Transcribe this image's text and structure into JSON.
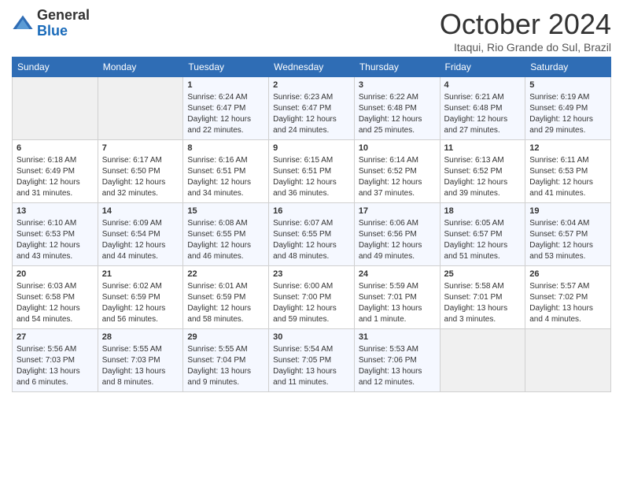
{
  "logo": {
    "general": "General",
    "blue": "Blue"
  },
  "header": {
    "month": "October 2024",
    "location": "Itaqui, Rio Grande do Sul, Brazil"
  },
  "days_of_week": [
    "Sunday",
    "Monday",
    "Tuesday",
    "Wednesday",
    "Thursday",
    "Friday",
    "Saturday"
  ],
  "weeks": [
    [
      {
        "day": "",
        "content": ""
      },
      {
        "day": "",
        "content": ""
      },
      {
        "day": "1",
        "content": "Sunrise: 6:24 AM\nSunset: 6:47 PM\nDaylight: 12 hours\nand 22 minutes."
      },
      {
        "day": "2",
        "content": "Sunrise: 6:23 AM\nSunset: 6:47 PM\nDaylight: 12 hours\nand 24 minutes."
      },
      {
        "day": "3",
        "content": "Sunrise: 6:22 AM\nSunset: 6:48 PM\nDaylight: 12 hours\nand 25 minutes."
      },
      {
        "day": "4",
        "content": "Sunrise: 6:21 AM\nSunset: 6:48 PM\nDaylight: 12 hours\nand 27 minutes."
      },
      {
        "day": "5",
        "content": "Sunrise: 6:19 AM\nSunset: 6:49 PM\nDaylight: 12 hours\nand 29 minutes."
      }
    ],
    [
      {
        "day": "6",
        "content": "Sunrise: 6:18 AM\nSunset: 6:49 PM\nDaylight: 12 hours\nand 31 minutes."
      },
      {
        "day": "7",
        "content": "Sunrise: 6:17 AM\nSunset: 6:50 PM\nDaylight: 12 hours\nand 32 minutes."
      },
      {
        "day": "8",
        "content": "Sunrise: 6:16 AM\nSunset: 6:51 PM\nDaylight: 12 hours\nand 34 minutes."
      },
      {
        "day": "9",
        "content": "Sunrise: 6:15 AM\nSunset: 6:51 PM\nDaylight: 12 hours\nand 36 minutes."
      },
      {
        "day": "10",
        "content": "Sunrise: 6:14 AM\nSunset: 6:52 PM\nDaylight: 12 hours\nand 37 minutes."
      },
      {
        "day": "11",
        "content": "Sunrise: 6:13 AM\nSunset: 6:52 PM\nDaylight: 12 hours\nand 39 minutes."
      },
      {
        "day": "12",
        "content": "Sunrise: 6:11 AM\nSunset: 6:53 PM\nDaylight: 12 hours\nand 41 minutes."
      }
    ],
    [
      {
        "day": "13",
        "content": "Sunrise: 6:10 AM\nSunset: 6:53 PM\nDaylight: 12 hours\nand 43 minutes."
      },
      {
        "day": "14",
        "content": "Sunrise: 6:09 AM\nSunset: 6:54 PM\nDaylight: 12 hours\nand 44 minutes."
      },
      {
        "day": "15",
        "content": "Sunrise: 6:08 AM\nSunset: 6:55 PM\nDaylight: 12 hours\nand 46 minutes."
      },
      {
        "day": "16",
        "content": "Sunrise: 6:07 AM\nSunset: 6:55 PM\nDaylight: 12 hours\nand 48 minutes."
      },
      {
        "day": "17",
        "content": "Sunrise: 6:06 AM\nSunset: 6:56 PM\nDaylight: 12 hours\nand 49 minutes."
      },
      {
        "day": "18",
        "content": "Sunrise: 6:05 AM\nSunset: 6:57 PM\nDaylight: 12 hours\nand 51 minutes."
      },
      {
        "day": "19",
        "content": "Sunrise: 6:04 AM\nSunset: 6:57 PM\nDaylight: 12 hours\nand 53 minutes."
      }
    ],
    [
      {
        "day": "20",
        "content": "Sunrise: 6:03 AM\nSunset: 6:58 PM\nDaylight: 12 hours\nand 54 minutes."
      },
      {
        "day": "21",
        "content": "Sunrise: 6:02 AM\nSunset: 6:59 PM\nDaylight: 12 hours\nand 56 minutes."
      },
      {
        "day": "22",
        "content": "Sunrise: 6:01 AM\nSunset: 6:59 PM\nDaylight: 12 hours\nand 58 minutes."
      },
      {
        "day": "23",
        "content": "Sunrise: 6:00 AM\nSunset: 7:00 PM\nDaylight: 12 hours\nand 59 minutes."
      },
      {
        "day": "24",
        "content": "Sunrise: 5:59 AM\nSunset: 7:01 PM\nDaylight: 13 hours\nand 1 minute."
      },
      {
        "day": "25",
        "content": "Sunrise: 5:58 AM\nSunset: 7:01 PM\nDaylight: 13 hours\nand 3 minutes."
      },
      {
        "day": "26",
        "content": "Sunrise: 5:57 AM\nSunset: 7:02 PM\nDaylight: 13 hours\nand 4 minutes."
      }
    ],
    [
      {
        "day": "27",
        "content": "Sunrise: 5:56 AM\nSunset: 7:03 PM\nDaylight: 13 hours\nand 6 minutes."
      },
      {
        "day": "28",
        "content": "Sunrise: 5:55 AM\nSunset: 7:03 PM\nDaylight: 13 hours\nand 8 minutes."
      },
      {
        "day": "29",
        "content": "Sunrise: 5:55 AM\nSunset: 7:04 PM\nDaylight: 13 hours\nand 9 minutes."
      },
      {
        "day": "30",
        "content": "Sunrise: 5:54 AM\nSunset: 7:05 PM\nDaylight: 13 hours\nand 11 minutes."
      },
      {
        "day": "31",
        "content": "Sunrise: 5:53 AM\nSunset: 7:06 PM\nDaylight: 13 hours\nand 12 minutes."
      },
      {
        "day": "",
        "content": ""
      },
      {
        "day": "",
        "content": ""
      }
    ]
  ]
}
